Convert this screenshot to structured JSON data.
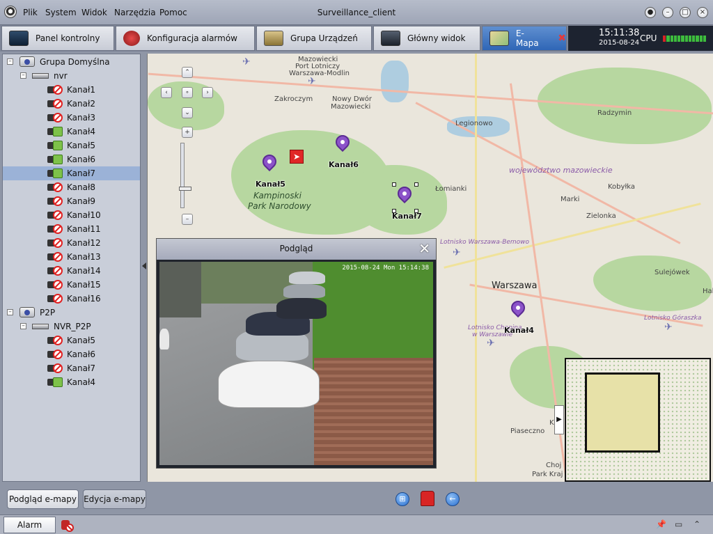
{
  "window": {
    "title": "Surveillance_client",
    "menu": [
      "Plik",
      "System",
      "Widok",
      "Narzędzia",
      "Pomoc"
    ]
  },
  "tabs": [
    {
      "label": "Panel kontrolny",
      "icon": "monitor-panel-icon"
    },
    {
      "label": "Konfiguracja alarmów",
      "icon": "alarm-config-icon"
    },
    {
      "label": "Grupa Urządzeń",
      "icon": "device-group-icon"
    },
    {
      "label": "Główny widok",
      "icon": "main-view-icon"
    },
    {
      "label": "E-Mapa",
      "icon": "emap-icon",
      "active": true
    }
  ],
  "status": {
    "time": "15:11:38",
    "date": "2015-08-24",
    "cpu_label": "CPU"
  },
  "tree": {
    "groups": [
      {
        "name": "Grupa Domyślna",
        "device": "nvr",
        "channels": [
          {
            "label": "Kanał1",
            "state": "offline"
          },
          {
            "label": "Kanał2",
            "state": "offline"
          },
          {
            "label": "Kanał3",
            "state": "offline"
          },
          {
            "label": "Kanał4",
            "state": "online"
          },
          {
            "label": "Kanał5",
            "state": "online"
          },
          {
            "label": "Kanał6",
            "state": "online"
          },
          {
            "label": "Kanał7",
            "state": "online",
            "selected": true
          },
          {
            "label": "Kanał8",
            "state": "offline"
          },
          {
            "label": "Kanał9",
            "state": "offline"
          },
          {
            "label": "Kanał10",
            "state": "offline"
          },
          {
            "label": "Kanał11",
            "state": "offline"
          },
          {
            "label": "Kanał12",
            "state": "offline"
          },
          {
            "label": "Kanał13",
            "state": "offline"
          },
          {
            "label": "Kanał14",
            "state": "offline"
          },
          {
            "label": "Kanał15",
            "state": "offline"
          },
          {
            "label": "Kanał16",
            "state": "offline"
          }
        ]
      },
      {
        "name": "P2P",
        "device": "NVR_P2P",
        "channels": [
          {
            "label": "Kanał5",
            "state": "offline"
          },
          {
            "label": "Kanał6",
            "state": "offline"
          },
          {
            "label": "Kanał7",
            "state": "offline"
          },
          {
            "label": "Kanał4",
            "state": "online"
          }
        ]
      }
    ]
  },
  "map": {
    "places": {
      "zakroczym": "Zakroczym",
      "nowy_dwor": "Nowy Dwór",
      "mazowiecki": "Mazowiecki",
      "legionowo": "Legionowo",
      "radzymin": "Radzymin",
      "lomianki": "Łomianki",
      "marki": "Marki",
      "kobylka": "Kobyłka",
      "zielonka": "Zielonka",
      "warszawa": "Warszawa",
      "sulejowek": "Sulejówek",
      "piaseczno": "Piaseczno",
      "region": "województwo mazowieckie",
      "park1": "Kampinoski",
      "park2": "Park Narodowy",
      "airport1a": "Mazowiecki",
      "airport1b": "Port Lotniczy",
      "airport1c": "Warszawa-Modlin",
      "airport2": "Lotnisko Warszawa-Bemowo",
      "airport3a": "Lotnisko Chopina",
      "airport3b": "w Warszawie",
      "airport4": "Lotnisko Góraszka",
      "chojnow_a": "Choj",
      "chojnow_b": "Park Kraj",
      "hal": "Hal",
      "kr": "Kr"
    },
    "cameras": [
      {
        "label": "Kanał5"
      },
      {
        "label": "Kanał6"
      },
      {
        "label": "Kanał7",
        "selected": true
      },
      {
        "label": "Kanał4"
      }
    ],
    "alarm_marker_icon": "alarm-exit-icon"
  },
  "preview": {
    "title": "Podgląd",
    "osd": "2015-08-24 Mon 15:14:38"
  },
  "bottom": {
    "btn_preview": "Podgląd e-mapy",
    "btn_edit": "Edycja e-mapy",
    "tab_alarm": "Alarm"
  }
}
